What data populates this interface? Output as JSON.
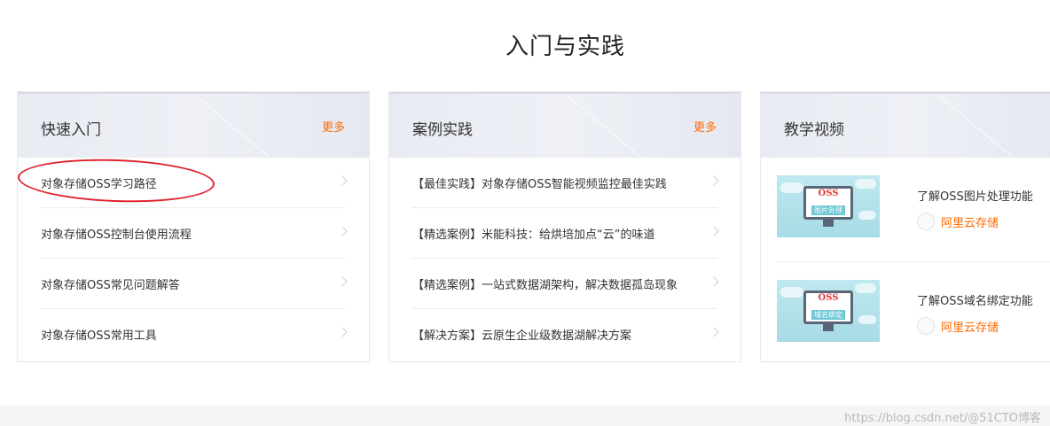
{
  "page": {
    "title": "入门与实践"
  },
  "cards": [
    {
      "title": "快速入门",
      "more_label": "更多",
      "items": [
        "对象存储OSS学习路径",
        "对象存储OSS控制台使用流程",
        "对象存储OSS常见问题解答",
        "对象存储OSS常用工具"
      ]
    },
    {
      "title": "案例实践",
      "more_label": "更多",
      "items": [
        "【最佳实践】对象存储OSS智能视频监控最佳实践",
        "【精选案例】米能科技：给烘培加点“云”的味道",
        "【精选案例】一站式数据湖架构，解决数据孤岛现象",
        "【解决方案】云原生企业级数据湖解决方案"
      ]
    },
    {
      "title": "教学视频",
      "videos": [
        {
          "title": "了解OSS图片处理功能",
          "author": "阿里云存储",
          "thumb_heading": "OSS",
          "thumb_label": "图片处理"
        },
        {
          "title": "了解OSS域名绑定功能",
          "author": "阿里云存储",
          "thumb_heading": "OSS",
          "thumb_label": "域名绑定"
        }
      ]
    }
  ],
  "annotation": {
    "color": "#e0202a",
    "target": "对象存储OSS学习路径"
  },
  "watermark": "https://blog.csdn.net/@51CTO博客",
  "colors": {
    "accent": "#ff6a00",
    "header_bg": "#eceef5"
  }
}
